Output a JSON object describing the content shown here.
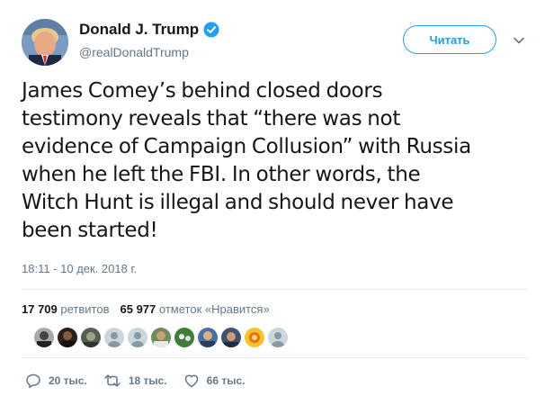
{
  "author": {
    "display_name": "Donald J. Trump",
    "handle": "@realDonaldTrump",
    "verified": true
  },
  "follow_button": {
    "label": "Читать"
  },
  "tweet": {
    "text_lines": [
      "James Comey’s behind closed doors",
      "testimony reveals that “there was not",
      "evidence of Campaign Collusion” with Russia",
      "when he left the FBI. In other words, the",
      "Witch Hunt is illegal and should never have",
      "been started!"
    ],
    "timestamp": "18:11 - 10 дек. 2018 г."
  },
  "stats": {
    "retweets_count": "17 709",
    "retweets_label": "ретвитов",
    "likes_count": "65 977",
    "likes_label": "отметок «Нравится»"
  },
  "likers": [
    "avatar-1",
    "avatar-2",
    "avatar-3",
    "default-avatar",
    "default-avatar",
    "avatar-6",
    "avatar-7",
    "avatar-8",
    "avatar-9",
    "avatar-10",
    "default-avatar"
  ],
  "actions": {
    "replies": "20 тыс.",
    "retweets": "18 тыс.",
    "likes": "66 тыс."
  },
  "colors": {
    "accent": "#1da1f2",
    "text": "#14171a",
    "secondary": "#657786",
    "divider": "#e6ecf0"
  }
}
